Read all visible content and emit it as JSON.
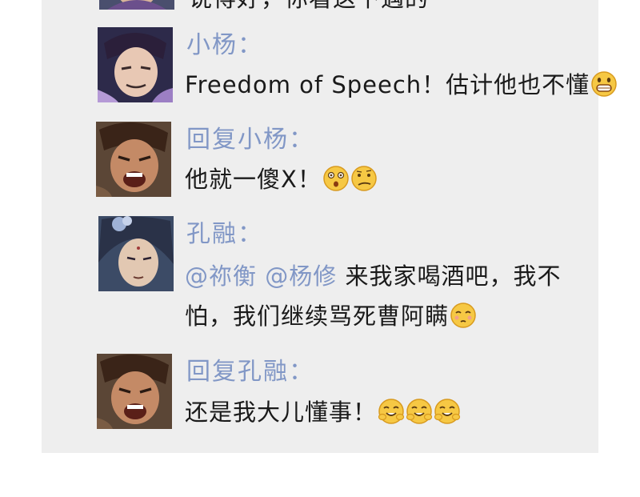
{
  "thread": {
    "partial_top_text": "说得好，你看这下遇的",
    "comments": [
      {
        "author": "小杨：",
        "text": "Freedom of Speech！估计他也不懂",
        "emojis": [
          "grin-emoji"
        ]
      },
      {
        "author": "回复小杨：",
        "text": "他就一傻X！",
        "emojis": [
          "dizzy-face-emoji",
          "confused-face-emoji"
        ]
      },
      {
        "author": "孔融：",
        "mentions": [
          "@祢衡",
          "@杨修"
        ],
        "text": "来我家喝酒吧，我不怕，我们继续骂死曹阿瞒",
        "emojis": [
          "smirk-face-emoji"
        ]
      },
      {
        "author": "回复孔融：",
        "text": "还是我大儿懂事！",
        "emojis": [
          "giggle-emoji",
          "giggle-emoji",
          "giggle-emoji"
        ]
      }
    ]
  },
  "colors": {
    "panel_bg": "#eeeeee",
    "name_color": "#8197c6",
    "text_color": "#1a1a1a",
    "emoji_yellow": "#f6c844"
  }
}
